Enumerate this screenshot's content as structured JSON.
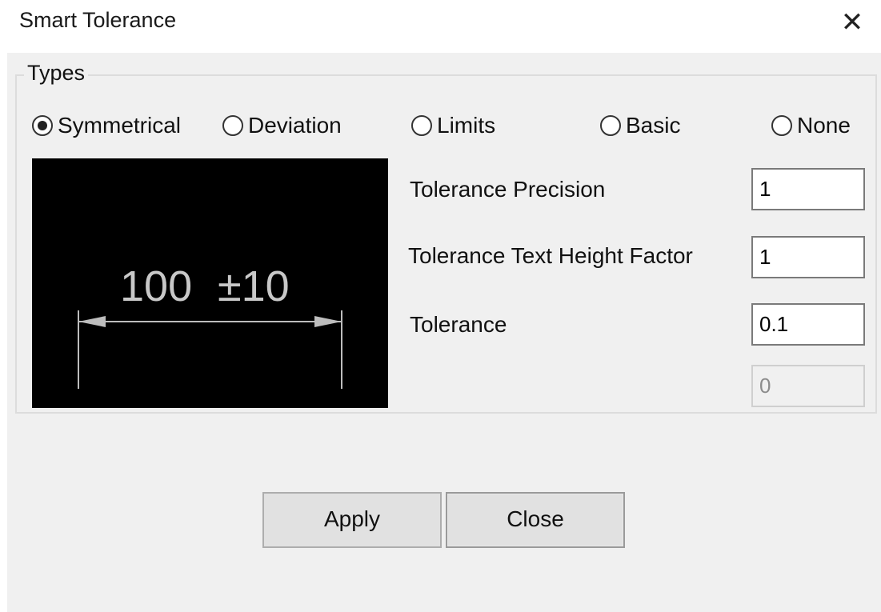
{
  "window": {
    "title": "Smart Tolerance",
    "close_glyph": "✕"
  },
  "types_group": {
    "legend": "Types",
    "selected": "Symmetrical",
    "options": [
      {
        "label": "Symmetrical",
        "checked": true
      },
      {
        "label": "Deviation",
        "checked": false
      },
      {
        "label": "Limits",
        "checked": false
      },
      {
        "label": "Basic",
        "checked": false
      },
      {
        "label": "None",
        "checked": false
      }
    ]
  },
  "preview": {
    "dimension_text": "100",
    "tolerance_text": "±10"
  },
  "fields": {
    "precision": {
      "label": "Tolerance Precision",
      "value": "1"
    },
    "text_height_factor": {
      "label": "Tolerance Text Height Factor",
      "value": "1"
    },
    "tolerance": {
      "label": "Tolerance",
      "value": "0.1"
    },
    "lower_tolerance": {
      "label": "",
      "value": "0",
      "enabled": false
    }
  },
  "buttons": {
    "apply": "Apply",
    "close": "Close"
  },
  "colors": {
    "client_bg": "#f0f0f0",
    "preview_bg": "#000000",
    "preview_fg": "#c8c8c8"
  }
}
